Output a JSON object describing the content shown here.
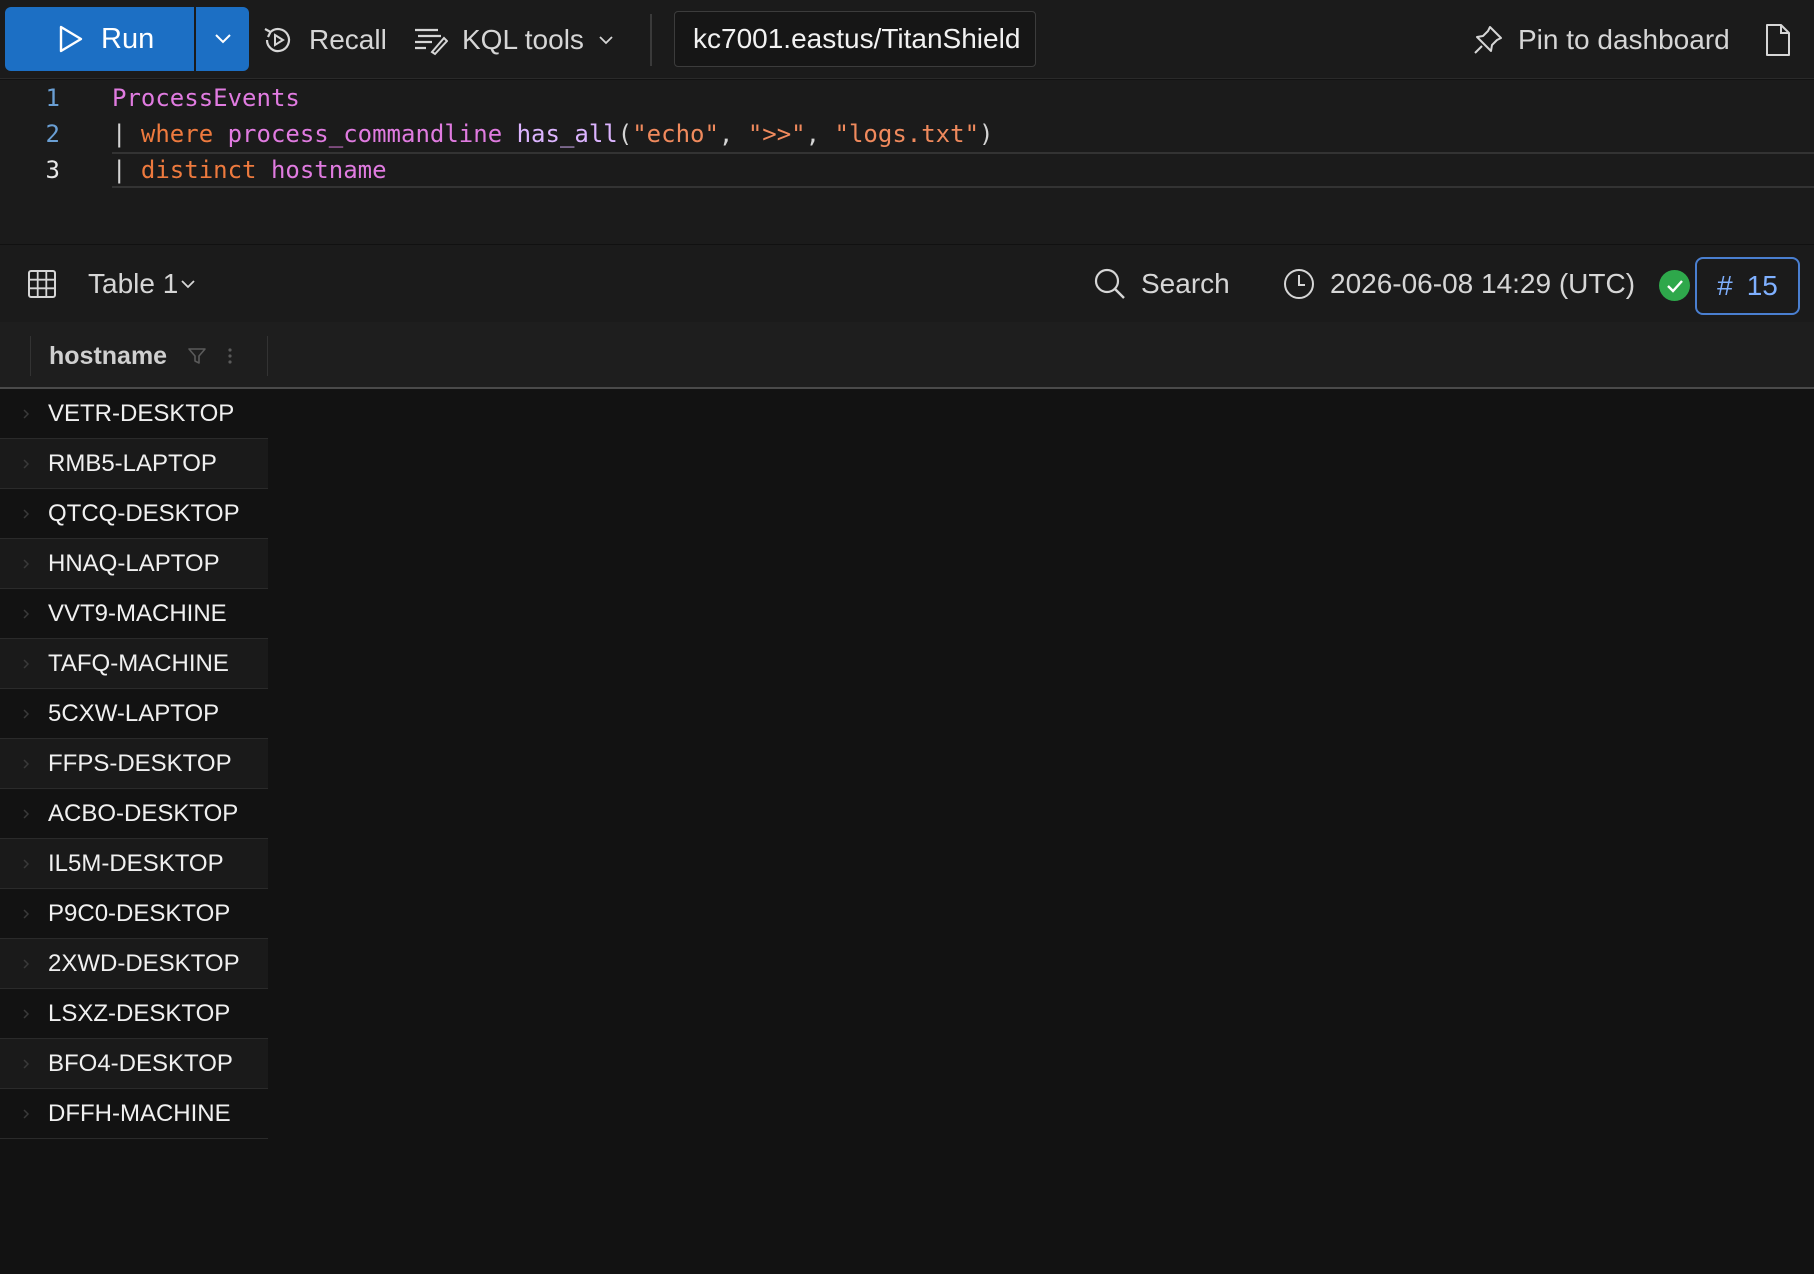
{
  "toolbar": {
    "run_label": "Run",
    "recall_label": "Recall",
    "kql_tools_label": "KQL tools",
    "cluster": "kc7001.eastus/TitanShield",
    "pin_label": "Pin to dashboard"
  },
  "editor": {
    "line_numbers": [
      "1",
      "2",
      "3"
    ],
    "line1": {
      "table": "ProcessEvents"
    },
    "line2": {
      "pipe": "|",
      "op": "where",
      "field": "process_commandline",
      "fn": "has_all",
      "open": "(",
      "arg1": "\"echo\"",
      "sep1": ", ",
      "arg2": "\">>\"",
      "sep2": ", ",
      "arg3": "\"logs.txt\"",
      "close": ")"
    },
    "line3": {
      "pipe": "|",
      "op": "distinct",
      "field": "hostname"
    }
  },
  "results": {
    "table_label": "Table 1",
    "search_label": "Search",
    "timestamp": "2026-06-08 14:29 (UTC)",
    "count_hash": "#",
    "count": "15"
  },
  "grid": {
    "column": "hostname",
    "rows": [
      "VETR-DESKTOP",
      "RMB5-LAPTOP",
      "QTCQ-DESKTOP",
      "HNAQ-LAPTOP",
      "VVT9-MACHINE",
      "TAFQ-MACHINE",
      "5CXW-LAPTOP",
      "FFPS-DESKTOP",
      "ACBO-DESKTOP",
      "IL5M-DESKTOP",
      "P9C0-DESKTOP",
      "2XWD-DESKTOP",
      "LSXZ-DESKTOP",
      "BFO4-DESKTOP",
      "DFFH-MACHINE"
    ]
  },
  "icons": {
    "run": "play-icon",
    "run_split": "chevron-down-icon",
    "recall": "history-icon",
    "kql_tools": "kql-tools-icon",
    "pin": "pin-icon",
    "document": "document-icon",
    "table": "table-grid-icon",
    "search": "search-icon",
    "clock": "clock-icon",
    "status": "check-circle-icon",
    "filter": "filter-icon",
    "more": "more-vertical-icon",
    "row_expand": "chevron-right-icon"
  },
  "colors": {
    "accent": "#1c6fc4",
    "success": "#2ea84b",
    "count_border": "#4a7fd0"
  }
}
